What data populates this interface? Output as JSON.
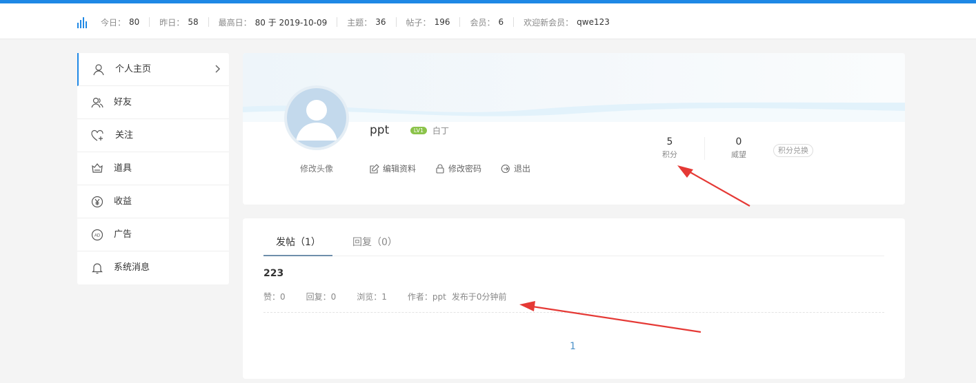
{
  "stats": [
    {
      "label": "今日：",
      "value": "80"
    },
    {
      "label": "昨日：",
      "value": "58"
    },
    {
      "label": "最高日：",
      "value": "80 于 2019-10-09"
    },
    {
      "label": "主题：",
      "value": "36"
    },
    {
      "label": "帖子：",
      "value": "196"
    },
    {
      "label": "会员：",
      "value": "6"
    },
    {
      "label": "欢迎新会员：",
      "value": "qwe123"
    }
  ],
  "sidebar": {
    "items": [
      {
        "label": "个人主页",
        "icon": "user-icon"
      },
      {
        "label": "好友",
        "icon": "friends-icon"
      },
      {
        "label": "关注",
        "icon": "heart-add-icon"
      },
      {
        "label": "道具",
        "icon": "gift-icon"
      },
      {
        "label": "收益",
        "icon": "yen-icon"
      },
      {
        "label": "广告",
        "icon": "ad-icon"
      },
      {
        "label": "系统消息",
        "icon": "bell-icon"
      }
    ]
  },
  "profile": {
    "username": "ppt",
    "badge": "LV1",
    "level_name": "白丁",
    "avatar_edit": "修改头像",
    "actions": {
      "edit_profile": "编辑资料",
      "change_password": "修改密码",
      "logout": "退出"
    },
    "points": {
      "value": "5",
      "label": "积分"
    },
    "prestige": {
      "value": "0",
      "label": "威望"
    },
    "exchange": "积分兑换"
  },
  "posts": {
    "tabs": [
      {
        "label": "发帖（1）"
      },
      {
        "label": "回复（0）"
      }
    ],
    "item": {
      "title": "223",
      "likes": "赞：0",
      "replies": "回复：0",
      "views": "浏览：1",
      "author": "作者：ppt",
      "time": "发布于0分钟前"
    },
    "page": "1"
  },
  "colors": {
    "accent": "#1e88e5",
    "arrow": "#e53935",
    "badge": "#8bc34a",
    "link": "#4a90c8"
  }
}
